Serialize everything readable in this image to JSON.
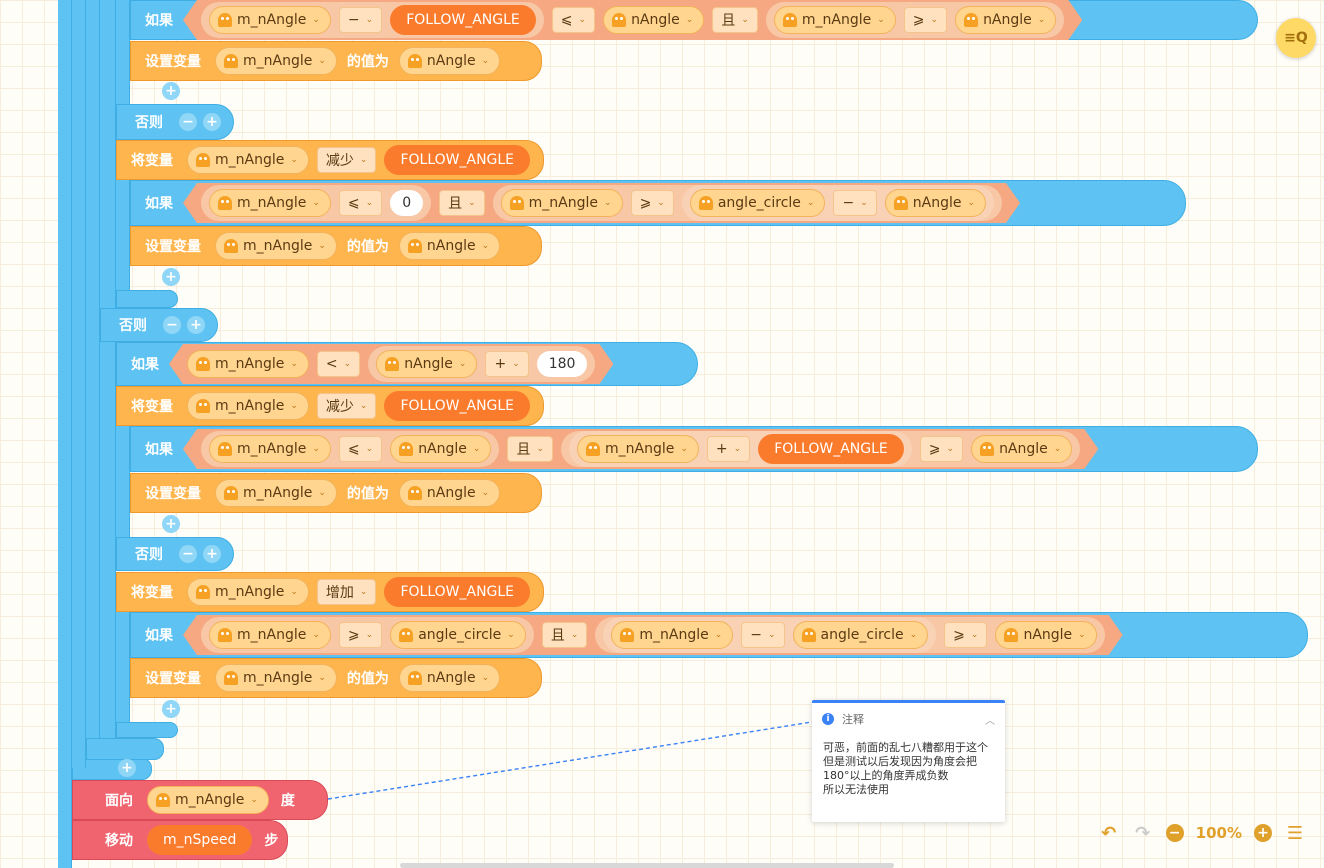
{
  "kw": {
    "if": "如果",
    "else": "否则",
    "setvar": "设置变量",
    "valueof": "的值为",
    "changevar": "将变量",
    "face": "面向",
    "deg": "度",
    "move": "移动",
    "step": "步",
    "and": "且"
  },
  "ops": {
    "minus": "−",
    "plus": "+",
    "le": "⩽",
    "ge": "⩾",
    "lt": "<",
    "dec": "减少",
    "inc": "增加"
  },
  "vars": {
    "m": "m_nAngle",
    "n": "nAngle",
    "ac": "angle_circle",
    "fa": "FOLLOW_ANGLE",
    "sp": "m_nSpeed"
  },
  "nums": {
    "zero": "0",
    "n180": "180"
  },
  "note": {
    "title": "注释",
    "body": "可恶，前面的乱七八糟都用于这个\n但是测试以后发现因为角度会把180°以上的角度弄成负数\n所以无法使用"
  },
  "zoom": "100%",
  "plus_label": "+",
  "minus_label": "−",
  "colors": {
    "blue": "#5ec2f2",
    "orange": "#ffb54d",
    "red": "#f0646f",
    "var": "#fb7b2c",
    "note": "#3b82f6"
  }
}
